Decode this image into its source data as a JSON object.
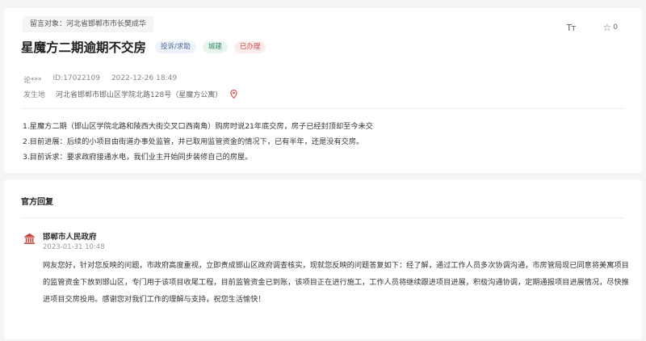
{
  "message": {
    "recipient": "留言对象：河北省邯郸市市长樊成华",
    "font_toggle": "Tт",
    "star_count": "0",
    "title": "星魔方二期逾期不交房",
    "tags": {
      "type": "投诉/求助",
      "field": "城建",
      "status": "已办理"
    },
    "author": "论***",
    "id": "ID:17022109",
    "datetime": "2022-12-26 18:49",
    "location_label": "发生地",
    "location": "河北省邯郸市邯山区学院北路128号（星魔方公寓）",
    "content": [
      "1.星魔方二期（邯山区学院北路和陵西大街交叉口西南角）购房时说21年底交房，房子已经封顶却至今未交",
      "2.目前进展：后续的小项目由街道办事处监管，并已取用监管资金的情况下，已有半年，还是没有交房。",
      "3.目前诉求：要求政府接通水电，我们业主开始同步装修自己的房屋。"
    ]
  },
  "reply": {
    "header": "官方回复",
    "org": "邯郸市人民政府",
    "datetime": "2023-01-31 10:48",
    "body": "网友您好，针对您反映的问题，市政府高度重视，立即责成邯山区政府调查核实，现就您反映的问题答复如下：经了解，通过工作人员多次协调沟通，市房管局现已同意将美寓项目的监管资金下放到邯山区，专门用于该项目收尾工程，目前监管资金已到账，该项目正在进行施工，工作人员将继续跟进项目进展，积极沟通协调，定期通报项目进展情况，尽快推进项目交房投用。感谢您对我们工作的理解与支持，祝您生活愉快！"
  },
  "colors": {
    "accent_red": "#d64a4a",
    "tag_green": "#2f8a63",
    "tag_blue": "#4d6a99",
    "avatar_red": "#c0392b"
  }
}
